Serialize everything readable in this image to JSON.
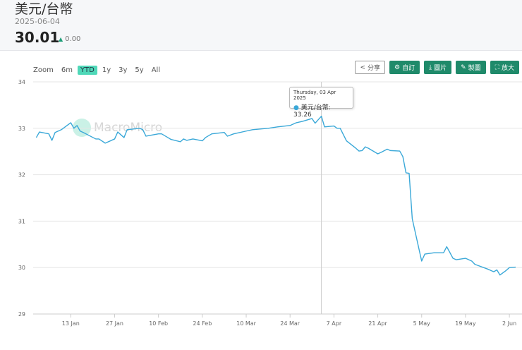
{
  "header": {
    "title": "美元/台幣",
    "date": "2025-06-04",
    "price": "30.01",
    "change": "0.00"
  },
  "range_selector": {
    "label": "Zoom",
    "options": [
      "6m",
      "YTD",
      "1y",
      "3y",
      "5y",
      "All"
    ],
    "active": "YTD"
  },
  "toolbar": [
    {
      "icon": "share-icon",
      "label": "分享"
    },
    {
      "icon": "gear-icon",
      "label": "自訂"
    },
    {
      "icon": "download-icon",
      "label": "圖片"
    },
    {
      "icon": "pencil-icon",
      "label": "製圖"
    },
    {
      "icon": "expand-icon",
      "label": "放大"
    }
  ],
  "watermark": "MacroMicro",
  "tooltip": {
    "date": "Thursday, 03 Apr 2025",
    "series": "美元/台幣",
    "value": "33.26"
  },
  "chart_data": {
    "type": "line",
    "title": "美元/台幣",
    "xlabel": "",
    "ylabel": "",
    "ylim": [
      29,
      34
    ],
    "yticks": [
      29,
      30,
      31,
      32,
      33,
      34
    ],
    "xlim": [
      "2025-01-01",
      "2025-06-04"
    ],
    "xticks": [
      {
        "date": "2025-01-13",
        "label": "13 Jan"
      },
      {
        "date": "2025-01-27",
        "label": "27 Jan"
      },
      {
        "date": "2025-02-10",
        "label": "10 Feb"
      },
      {
        "date": "2025-02-24",
        "label": "24 Feb"
      },
      {
        "date": "2025-03-10",
        "label": "10 Mar"
      },
      {
        "date": "2025-03-24",
        "label": "24 Mar"
      },
      {
        "date": "2025-04-07",
        "label": "7 Apr"
      },
      {
        "date": "2025-04-21",
        "label": "21 Apr"
      },
      {
        "date": "2025-05-05",
        "label": "5 May"
      },
      {
        "date": "2025-05-19",
        "label": "19 May"
      },
      {
        "date": "2025-06-02",
        "label": "2 Jun"
      }
    ],
    "color": "#3aa8d8",
    "series": [
      {
        "name": "美元/台幣",
        "points": [
          [
            "2025-01-02",
            32.8
          ],
          [
            "2025-01-03",
            32.92
          ],
          [
            "2025-01-06",
            32.88
          ],
          [
            "2025-01-07",
            32.74
          ],
          [
            "2025-01-08",
            32.91
          ],
          [
            "2025-01-10",
            32.97
          ],
          [
            "2025-01-13",
            33.12
          ],
          [
            "2025-01-14",
            33.0
          ],
          [
            "2025-01-15",
            33.06
          ],
          [
            "2025-01-16",
            32.94
          ],
          [
            "2025-01-17",
            32.91
          ],
          [
            "2025-01-21",
            32.77
          ],
          [
            "2025-01-22",
            32.77
          ],
          [
            "2025-01-24",
            32.68
          ],
          [
            "2025-01-27",
            32.77
          ],
          [
            "2025-01-28",
            32.92
          ],
          [
            "2025-01-30",
            32.8
          ],
          [
            "2025-01-31",
            32.97
          ],
          [
            "2025-02-04",
            33.0
          ],
          [
            "2025-02-05",
            32.97
          ],
          [
            "2025-02-06",
            32.83
          ],
          [
            "2025-02-10",
            32.88
          ],
          [
            "2025-02-11",
            32.88
          ],
          [
            "2025-02-13",
            32.8
          ],
          [
            "2025-02-14",
            32.76
          ],
          [
            "2025-02-17",
            32.71
          ],
          [
            "2025-02-18",
            32.77
          ],
          [
            "2025-02-19",
            32.74
          ],
          [
            "2025-02-21",
            32.77
          ],
          [
            "2025-02-24",
            32.73
          ],
          [
            "2025-02-25",
            32.8
          ],
          [
            "2025-02-27",
            32.88
          ],
          [
            "2025-03-03",
            32.91
          ],
          [
            "2025-03-04",
            32.83
          ],
          [
            "2025-03-06",
            32.88
          ],
          [
            "2025-03-10",
            32.94
          ],
          [
            "2025-03-12",
            32.97
          ],
          [
            "2025-03-17",
            33.0
          ],
          [
            "2025-03-20",
            33.03
          ],
          [
            "2025-03-24",
            33.06
          ],
          [
            "2025-03-26",
            33.12
          ],
          [
            "2025-03-28",
            33.15
          ],
          [
            "2025-03-31",
            33.21
          ],
          [
            "2025-04-01",
            33.11
          ],
          [
            "2025-04-03",
            33.26
          ],
          [
            "2025-04-04",
            33.03
          ],
          [
            "2025-04-07",
            33.05
          ],
          [
            "2025-04-08",
            33.0
          ],
          [
            "2025-04-09",
            33.0
          ],
          [
            "2025-04-11",
            32.73
          ],
          [
            "2025-04-14",
            32.57
          ],
          [
            "2025-04-15",
            32.51
          ],
          [
            "2025-04-16",
            32.52
          ],
          [
            "2025-04-17",
            32.6
          ],
          [
            "2025-04-18",
            32.57
          ],
          [
            "2025-04-21",
            32.45
          ],
          [
            "2025-04-22",
            32.48
          ],
          [
            "2025-04-24",
            32.55
          ],
          [
            "2025-04-25",
            32.52
          ],
          [
            "2025-04-28",
            32.51
          ],
          [
            "2025-04-29",
            32.39
          ],
          [
            "2025-04-30",
            32.04
          ],
          [
            "2025-05-01",
            32.03
          ],
          [
            "2025-05-02",
            31.05
          ],
          [
            "2025-05-05",
            30.14
          ],
          [
            "2025-05-06",
            30.29
          ],
          [
            "2025-05-09",
            30.32
          ],
          [
            "2025-05-12",
            30.32
          ],
          [
            "2025-05-13",
            30.45
          ],
          [
            "2025-05-15",
            30.2
          ],
          [
            "2025-05-16",
            30.17
          ],
          [
            "2025-05-19",
            30.2
          ],
          [
            "2025-05-21",
            30.14
          ],
          [
            "2025-05-22",
            30.07
          ],
          [
            "2025-05-26",
            29.97
          ],
          [
            "2025-05-27",
            29.94
          ],
          [
            "2025-05-28",
            29.91
          ],
          [
            "2025-05-29",
            29.95
          ],
          [
            "2025-05-30",
            29.84
          ],
          [
            "2025-06-01",
            29.94
          ],
          [
            "2025-06-02",
            30.0
          ],
          [
            "2025-06-04",
            30.01
          ]
        ]
      }
    ],
    "highlight": {
      "date": "2025-04-03",
      "value": 33.26
    }
  }
}
